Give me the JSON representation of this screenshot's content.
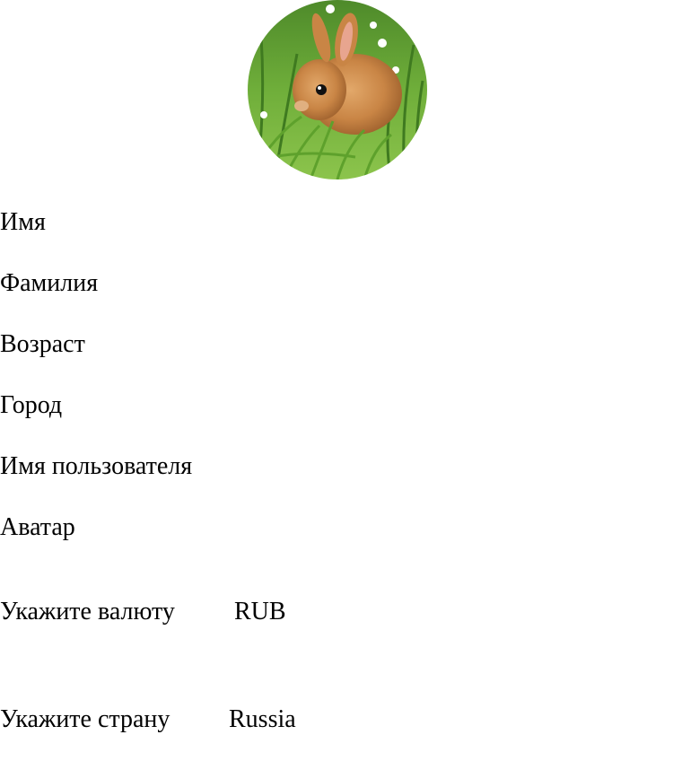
{
  "profile": {
    "avatar_icon": "rabbit-photo",
    "fields": [
      {
        "label": "Имя"
      },
      {
        "label": "Фамилия"
      },
      {
        "label": "Возраст"
      },
      {
        "label": "Город"
      },
      {
        "label": "Имя пользователя"
      },
      {
        "label": "Аватар"
      }
    ]
  },
  "currency": {
    "label": "Укажите валюту",
    "value": "RUB"
  },
  "country": {
    "label": "Укажите страну",
    "value": "Russia"
  }
}
